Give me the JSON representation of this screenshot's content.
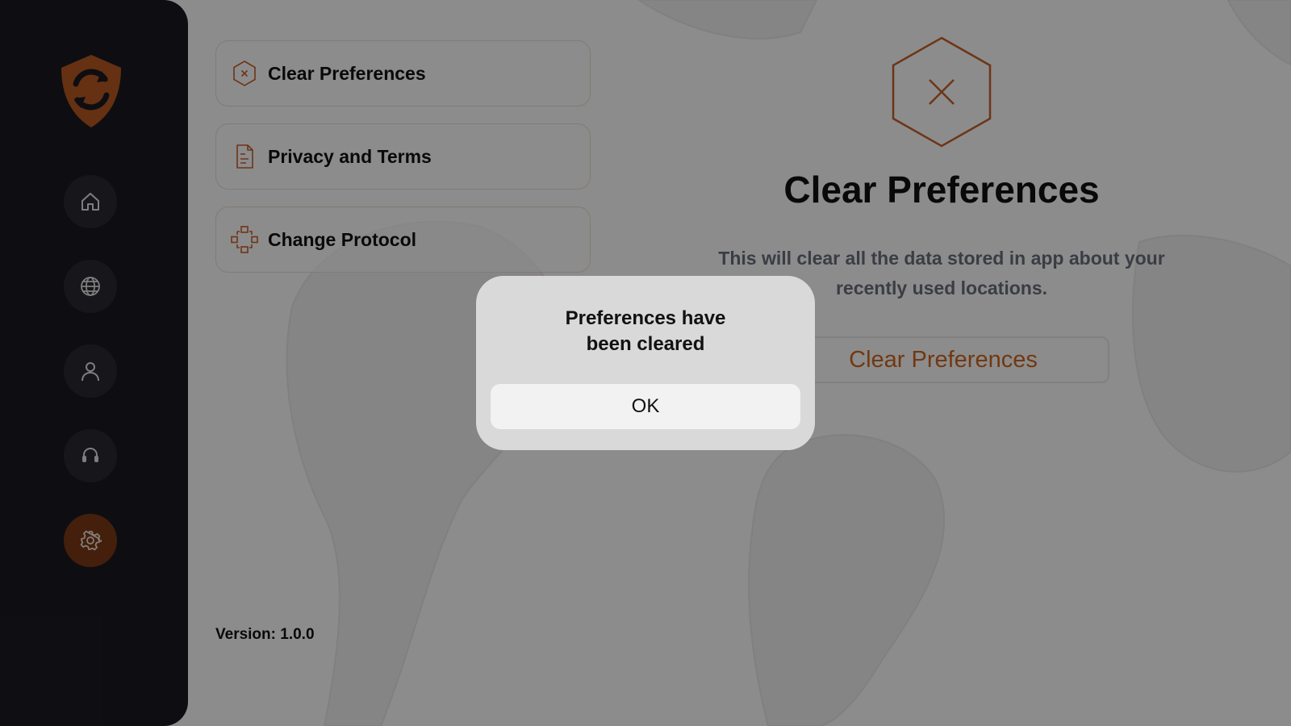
{
  "sidebar": {
    "logo_icon": "shield-refresh-logo",
    "items": [
      {
        "name": "home",
        "icon": "home-icon",
        "active": false
      },
      {
        "name": "locations",
        "icon": "globe-icon",
        "active": false
      },
      {
        "name": "account",
        "icon": "user-icon",
        "active": false
      },
      {
        "name": "support",
        "icon": "headset-icon",
        "active": false
      },
      {
        "name": "settings",
        "icon": "gear-icon",
        "active": true
      }
    ]
  },
  "settings_menu": {
    "items": [
      {
        "label": "Clear Preferences",
        "icon": "hexagon-x-icon"
      },
      {
        "label": "Privacy and Terms",
        "icon": "document-icon"
      },
      {
        "label": "Change Protocol",
        "icon": "protocol-icon"
      }
    ],
    "version": "Version: 1.0.0"
  },
  "detail": {
    "icon": "hexagon-x-icon",
    "title": "Clear Preferences",
    "description": "This will clear all the data stored in app about your recently used locations.",
    "button_label": "Clear Preferences"
  },
  "alert": {
    "title": "Preferences have\nbeen cleared",
    "ok_label": "OK"
  },
  "colors": {
    "accent": "#d0661f",
    "sidebar_bg": "#1b1a22",
    "active_nav": "#7a3a17",
    "overlay": "rgba(0,0,0,0.45)"
  }
}
